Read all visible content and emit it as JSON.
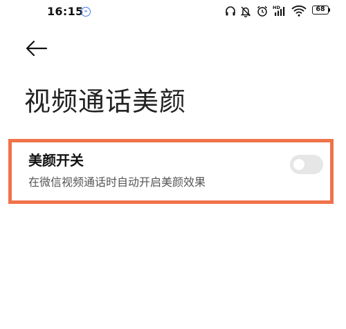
{
  "status_bar": {
    "time": "16:15",
    "notification_badge": "∞",
    "battery_level": "68",
    "network_label": "HD"
  },
  "page": {
    "title": "视频通话美颜"
  },
  "setting": {
    "label": "美颜开关",
    "description": "在微信视频通话时自动开启美颜效果",
    "enabled": false
  },
  "colors": {
    "highlight_border": "#f0734a",
    "toggle_off": "#e6e6e6"
  }
}
